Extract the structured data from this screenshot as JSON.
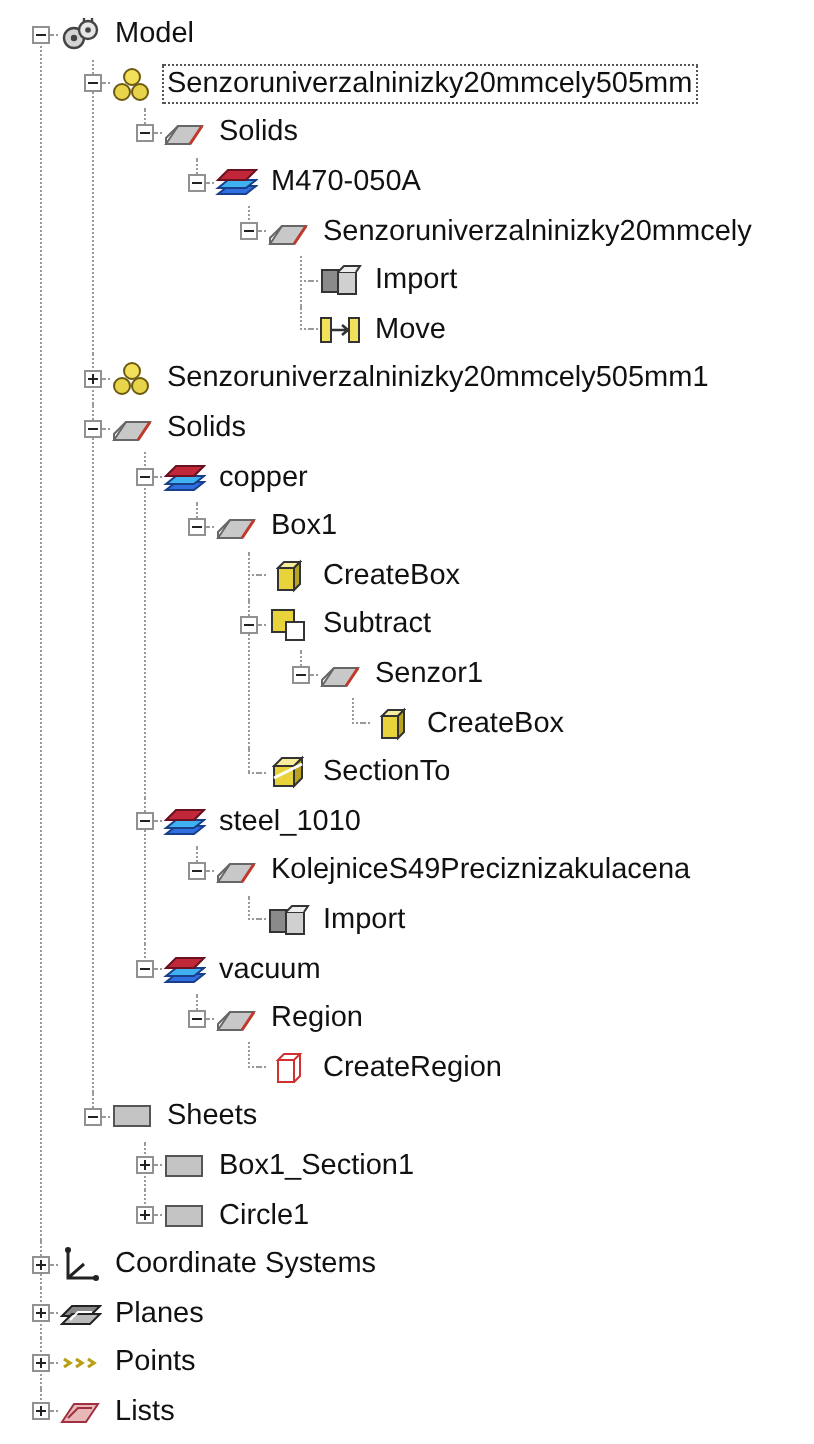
{
  "tree": [
    {
      "label": "Model",
      "kind": "model",
      "selected": false,
      "expanded": true,
      "children": [
        {
          "label": "Senzoruniverzalninizky20mmcely505mm",
          "kind": "part",
          "selected": true,
          "expanded": true,
          "children": [
            {
              "label": "Solids",
              "kind": "solid",
              "selected": false,
              "expanded": true,
              "children": [
                {
                  "label": "M470-050A",
                  "kind": "material",
                  "selected": false,
                  "expanded": true,
                  "children": [
                    {
                      "label": "Senzoruniverzalninizky20mmcely",
                      "kind": "solid",
                      "selected": false,
                      "expanded": true,
                      "children": [
                        {
                          "label": "Import",
                          "kind": "import",
                          "selected": false
                        },
                        {
                          "label": "Move",
                          "kind": "move",
                          "selected": false
                        }
                      ]
                    }
                  ]
                }
              ]
            }
          ]
        },
        {
          "label": "Senzoruniverzalninizky20mmcely505mm1",
          "kind": "part",
          "selected": false,
          "expanded": false
        },
        {
          "label": "Solids",
          "kind": "solid",
          "selected": false,
          "expanded": true,
          "children": [
            {
              "label": "copper",
              "kind": "material",
              "selected": false,
              "expanded": true,
              "children": [
                {
                  "label": "Box1",
                  "kind": "solid",
                  "selected": false,
                  "expanded": true,
                  "children": [
                    {
                      "label": "CreateBox",
                      "kind": "box",
                      "selected": false
                    },
                    {
                      "label": "Subtract",
                      "kind": "subtract",
                      "selected": false,
                      "expanded": true,
                      "children": [
                        {
                          "label": "Senzor1",
                          "kind": "solid",
                          "selected": false,
                          "expanded": true,
                          "children": [
                            {
                              "label": "CreateBox",
                              "kind": "box",
                              "selected": false
                            }
                          ]
                        }
                      ]
                    },
                    {
                      "label": "SectionTo",
                      "kind": "section",
                      "selected": false
                    }
                  ]
                }
              ]
            },
            {
              "label": "steel_1010",
              "kind": "material",
              "selected": false,
              "expanded": true,
              "children": [
                {
                  "label": "KolejniceS49Preciznizakulacena",
                  "kind": "solid",
                  "selected": false,
                  "expanded": true,
                  "children": [
                    {
                      "label": "Import",
                      "kind": "import",
                      "selected": false
                    }
                  ]
                }
              ]
            },
            {
              "label": "vacuum",
              "kind": "material",
              "selected": false,
              "expanded": true,
              "children": [
                {
                  "label": "Region",
                  "kind": "solid",
                  "selected": false,
                  "expanded": true,
                  "children": [
                    {
                      "label": "CreateRegion",
                      "kind": "region",
                      "selected": false
                    }
                  ]
                }
              ]
            }
          ]
        },
        {
          "label": "Sheets",
          "kind": "sheet",
          "selected": false,
          "expanded": true,
          "children": [
            {
              "label": "Box1_Section1",
              "kind": "sheet",
              "selected": false,
              "expanded": false
            },
            {
              "label": "Circle1",
              "kind": "sheet",
              "selected": false,
              "expanded": false
            }
          ]
        }
      ]
    },
    {
      "label": "Coordinate Systems",
      "kind": "coords",
      "selected": false,
      "expanded": false
    },
    {
      "label": "Planes",
      "kind": "planes",
      "selected": false,
      "expanded": false
    },
    {
      "label": "Points",
      "kind": "points",
      "selected": false,
      "expanded": false
    },
    {
      "label": "Lists",
      "kind": "lists",
      "selected": false,
      "expanded": false
    }
  ]
}
